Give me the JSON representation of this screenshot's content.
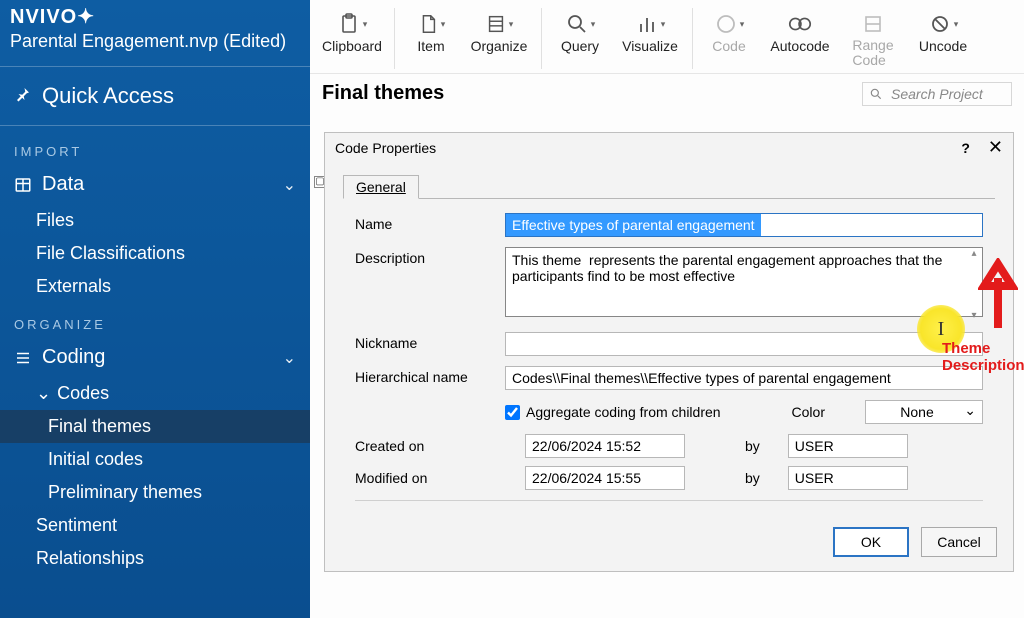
{
  "brand": "NVIVO",
  "projectName": "Parental Engagement.nvp (Edited)",
  "quickAccess": "Quick Access",
  "sections": {
    "import": "IMPORT",
    "organize": "ORGANIZE"
  },
  "sidebar": {
    "data": {
      "label": "Data",
      "items": [
        "Files",
        "File Classifications",
        "Externals"
      ]
    },
    "coding": {
      "label": "Coding",
      "codes": {
        "label": "Codes",
        "items": [
          "Final themes",
          "Initial codes",
          "Preliminary themes"
        ]
      },
      "sentiment": "Sentiment",
      "relationships": "Relationships"
    }
  },
  "ribbon": {
    "clipboard": "Clipboard",
    "item": "Item",
    "organize": "Organize",
    "query": "Query",
    "visualize": "Visualize",
    "code": "Code",
    "autocode": "Autocode",
    "rangecode": "Range\nCode",
    "uncode": "Uncode"
  },
  "heading": "Final themes",
  "search": {
    "placeholder": "Search Project"
  },
  "dialog": {
    "title": "Code Properties",
    "tab": "General",
    "labels": {
      "name": "Name",
      "description": "Description",
      "nickname": "Nickname",
      "hierarchical": "Hierarchical name",
      "aggregate": "Aggregate coding from children",
      "color": "Color",
      "created": "Created on",
      "modified": "Modified on",
      "by": "by"
    },
    "values": {
      "name": "Effective types of parental engagement",
      "description": "This theme  represents the parental engagement approaches that the participants find to be most effective",
      "nickname": "",
      "hierarchical": "Codes\\\\Final themes\\\\Effective types of parental engagement",
      "aggregate": true,
      "color": "None",
      "created": "22/06/2024 15:52",
      "createdBy": "USER",
      "modified": "22/06/2024 15:55",
      "modifiedBy": "USER"
    },
    "buttons": {
      "ok": "OK",
      "cancel": "Cancel"
    }
  },
  "annotation": {
    "label": "Theme Description"
  }
}
